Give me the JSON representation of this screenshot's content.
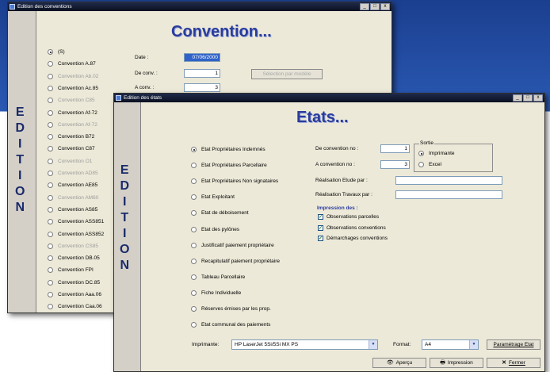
{
  "conventions_window": {
    "title": "Edition des conventions",
    "heading": "Convention...",
    "side_label": [
      "E",
      "D",
      "I",
      "T",
      "I",
      "O",
      "N"
    ],
    "radio_items": [
      {
        "label": "(S)",
        "enabled": true,
        "checked": true
      },
      {
        "label": "Convention A.87",
        "enabled": true,
        "checked": false
      },
      {
        "label": "Convention Ab.02",
        "enabled": false,
        "checked": false
      },
      {
        "label": "Convention Ac.85",
        "enabled": true,
        "checked": false
      },
      {
        "label": "Convention C85",
        "enabled": false,
        "checked": false
      },
      {
        "label": "Convention Af-72",
        "enabled": true,
        "checked": false
      },
      {
        "label": "Convention Af-72",
        "enabled": false,
        "checked": false
      },
      {
        "label": "Convention B72",
        "enabled": true,
        "checked": false
      },
      {
        "label": "Convention C87",
        "enabled": true,
        "checked": false
      },
      {
        "label": "Convention O1",
        "enabled": false,
        "checked": false
      },
      {
        "label": "Convention AD85",
        "enabled": false,
        "checked": false
      },
      {
        "label": "Convention AE85",
        "enabled": true,
        "checked": false
      },
      {
        "label": "Convention AM60",
        "enabled": false,
        "checked": false
      },
      {
        "label": "Convention AS85",
        "enabled": true,
        "checked": false
      },
      {
        "label": "Convention ASS851",
        "enabled": true,
        "checked": false
      },
      {
        "label": "Convention ASS852",
        "enabled": true,
        "checked": false
      },
      {
        "label": "Convention CS85",
        "enabled": false,
        "checked": false
      },
      {
        "label": "Convention DB.05",
        "enabled": true,
        "checked": false
      },
      {
        "label": "Convention FPI",
        "enabled": true,
        "checked": false
      },
      {
        "label": "Convention DC.85",
        "enabled": true,
        "checked": false
      },
      {
        "label": "Convention Aaa.06",
        "enabled": true,
        "checked": false
      },
      {
        "label": "Convention Caa.06",
        "enabled": true,
        "checked": false
      }
    ],
    "date_label": "Date :",
    "date_value": "07/06/2000",
    "de_conv_label": "De conv. :",
    "de_conv_value": "1",
    "a_conv_label": "A conv. :",
    "a_conv_value": "3",
    "select_model_button": "Sélection par modèle"
  },
  "etats_window": {
    "title": "Edition des états",
    "heading": "Etats...",
    "side_label": [
      "E",
      "D",
      "I",
      "T",
      "I",
      "O",
      "N"
    ],
    "radio_items": [
      {
        "label": "Etat Propriétaires Indemnés",
        "checked": true
      },
      {
        "label": "Etat Propriétaires Parcellaire",
        "checked": false
      },
      {
        "label": "Etat Propriétaires Non signataires",
        "checked": false
      },
      {
        "label": "Etat Exploitant",
        "checked": false
      },
      {
        "label": "Etat de déboisement",
        "checked": false
      },
      {
        "label": "Etat des pylônes",
        "checked": false
      },
      {
        "label": "Justificatif paiement  propriétaire",
        "checked": false
      },
      {
        "label": "Recapitulatif paiement  propriétaire",
        "checked": false
      },
      {
        "label": "Tableau Parcellaire",
        "checked": false
      },
      {
        "label": "Fiche Individuelle",
        "checked": false
      },
      {
        "label": "Réserves émises par les prop.",
        "checked": false
      },
      {
        "label": "Etat communal des paiements",
        "checked": false
      }
    ],
    "de_convention_label": "De convention no :",
    "de_convention_value": "1",
    "a_convention_label": "A convention no :",
    "a_convention_value": "3",
    "sortie": {
      "title": "Sortie",
      "options": [
        {
          "label": "Imprimante",
          "checked": true
        },
        {
          "label": "Excel",
          "checked": false
        }
      ]
    },
    "realisation_etude_label": "Réalisation Etude par :",
    "realisation_etude_value": "",
    "realisation_travaux_label": "Réalisation Travaux par :",
    "realisation_travaux_value": "",
    "impression_title": "Impression des :",
    "impression_items": [
      {
        "label": "Observations parcelles",
        "checked": true
      },
      {
        "label": "Observations conventions",
        "checked": true
      },
      {
        "label": "Démarchages conventions",
        "checked": true
      }
    ],
    "imprimante_label": "Imprimante:",
    "imprimante_value": "HP LaserJet 5Si/5Si MX PS",
    "format_label": "Format:",
    "format_value": "A4",
    "parametrage_button": "Paramétrage Etat",
    "apercu_button": "Aperçu",
    "impression_button": "Impression",
    "fermer_button": "Fermer"
  },
  "colors": {
    "window_bg": "#ece9d8",
    "heading_blue": "#2a3c9a",
    "titlebar": "#0b1020"
  }
}
